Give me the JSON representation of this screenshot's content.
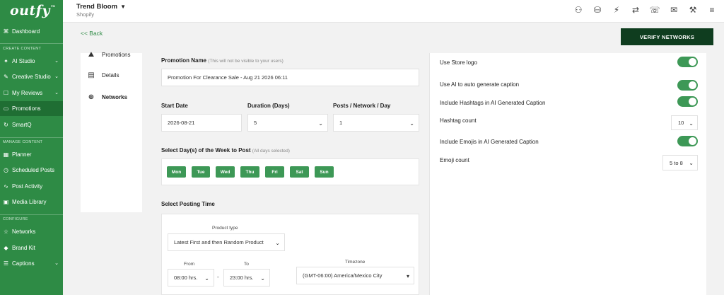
{
  "app": {
    "logo": "outfy",
    "logo_tm": "™"
  },
  "sidebar": {
    "sections": {
      "create": "CREATE CONTENT",
      "manage": "MANAGE CONTENT",
      "configure": "CONFIGURE"
    },
    "items": [
      {
        "label": "Dashboard",
        "icon": "grid-icon"
      },
      {
        "label": "AI Studio",
        "icon": "ai-icon"
      },
      {
        "label": "Creative Studio",
        "icon": "palette-icon"
      },
      {
        "label": "My Reviews",
        "icon": "review-icon"
      },
      {
        "label": "Promotions",
        "icon": "promo-icon"
      },
      {
        "label": "SmartQ",
        "icon": "smartq-icon"
      },
      {
        "label": "Planner",
        "icon": "calendar-icon"
      },
      {
        "label": "Scheduled Posts",
        "icon": "clock-icon"
      },
      {
        "label": "Post Activity",
        "icon": "activity-icon"
      },
      {
        "label": "Media Library",
        "icon": "image-icon"
      },
      {
        "label": "Networks",
        "icon": "star-icon"
      },
      {
        "label": "Brand Kit",
        "icon": "brand-icon"
      },
      {
        "label": "Captions",
        "icon": "caption-icon"
      }
    ],
    "active": "Promotions"
  },
  "topbar": {
    "store_name": "Trend Bloom",
    "store_platform": "Shopify",
    "icons": [
      "user-icon",
      "coins-icon",
      "magic-icon",
      "handshake-icon",
      "support-icon",
      "mail-icon",
      "tools-icon",
      "menu-icon"
    ]
  },
  "nav": {
    "back_label": "<< Back",
    "verify_label": "VERIFY NETWORKS"
  },
  "tabs": [
    {
      "label": "Promotions"
    },
    {
      "label": "Details"
    },
    {
      "label": "Networks"
    }
  ],
  "form": {
    "promotion_name_label": "Promotion Name",
    "promotion_name_note": "(This will not be visible to your users)",
    "promotion_name_value": "Promotion For Clearance Sale - Aug 21 2026 06:11",
    "start_date_label": "Start Date",
    "start_date_value": "2026-08-21",
    "duration_label": "Duration (Days)",
    "duration_value": "5",
    "posts_label": "Posts / Network / Day",
    "posts_value": "1",
    "days_label": "Select Day(s) of the Week to Post",
    "days_note": "(All days selected)",
    "days": [
      "Mon",
      "Tue",
      "Wed",
      "Thu",
      "Fri",
      "Sat",
      "Sun"
    ],
    "time_label": "Select Posting Time",
    "product_type_label": "Product type",
    "product_type_value": "Latest First and then Random Product",
    "from_label": "From",
    "from_value": "08:00 hrs.",
    "to_label": "To",
    "to_value": "23:00 hrs.",
    "dash": "-",
    "timezone_label": "Timezone",
    "timezone_value": "(GMT-06:00) America/Mexico City"
  },
  "options": {
    "store_logo": "Use Store logo",
    "ai_caption": "Use AI to auto generate caption",
    "hashtags": "Include Hashtags in AI Generated Caption",
    "hashtag_count_label": "Hashtag count",
    "hashtag_count_value": "10",
    "emojis": "Include Emojis in AI Generated Caption",
    "emoji_count_label": "Emoji count",
    "emoji_count_value": "5 to 8"
  },
  "colors": {
    "brand": "#2e8b45",
    "dark": "#0f3d1f",
    "toggle": "#3d9856"
  }
}
